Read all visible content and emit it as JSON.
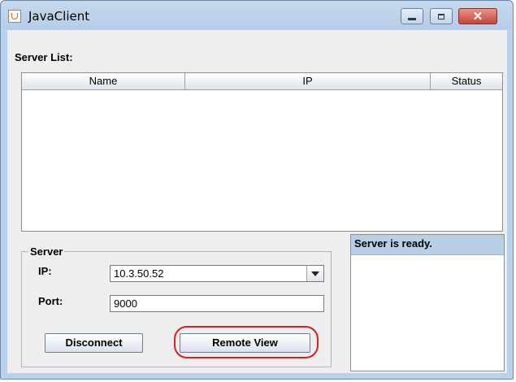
{
  "window": {
    "title": "JavaClient"
  },
  "server_list": {
    "label": "Server List:",
    "columns": [
      "Name",
      "IP",
      "Status"
    ],
    "rows": []
  },
  "server_group": {
    "title": "Server",
    "ip_label": "IP:",
    "ip_value": "10.3.50.52",
    "port_label": "Port:",
    "port_value": "9000"
  },
  "buttons": {
    "disconnect": "Disconnect",
    "remote_view": "Remote View"
  },
  "status": {
    "message": "Server is ready."
  },
  "icons": {
    "app": "java-coffee-cup-icon",
    "minimize": "minimize-icon",
    "maximize": "maximize-icon",
    "close": "close-icon",
    "dropdown": "chevron-down-icon"
  },
  "colors": {
    "highlight_ring": "#d81e1e",
    "status_header_bg": "#b8cfe5"
  }
}
